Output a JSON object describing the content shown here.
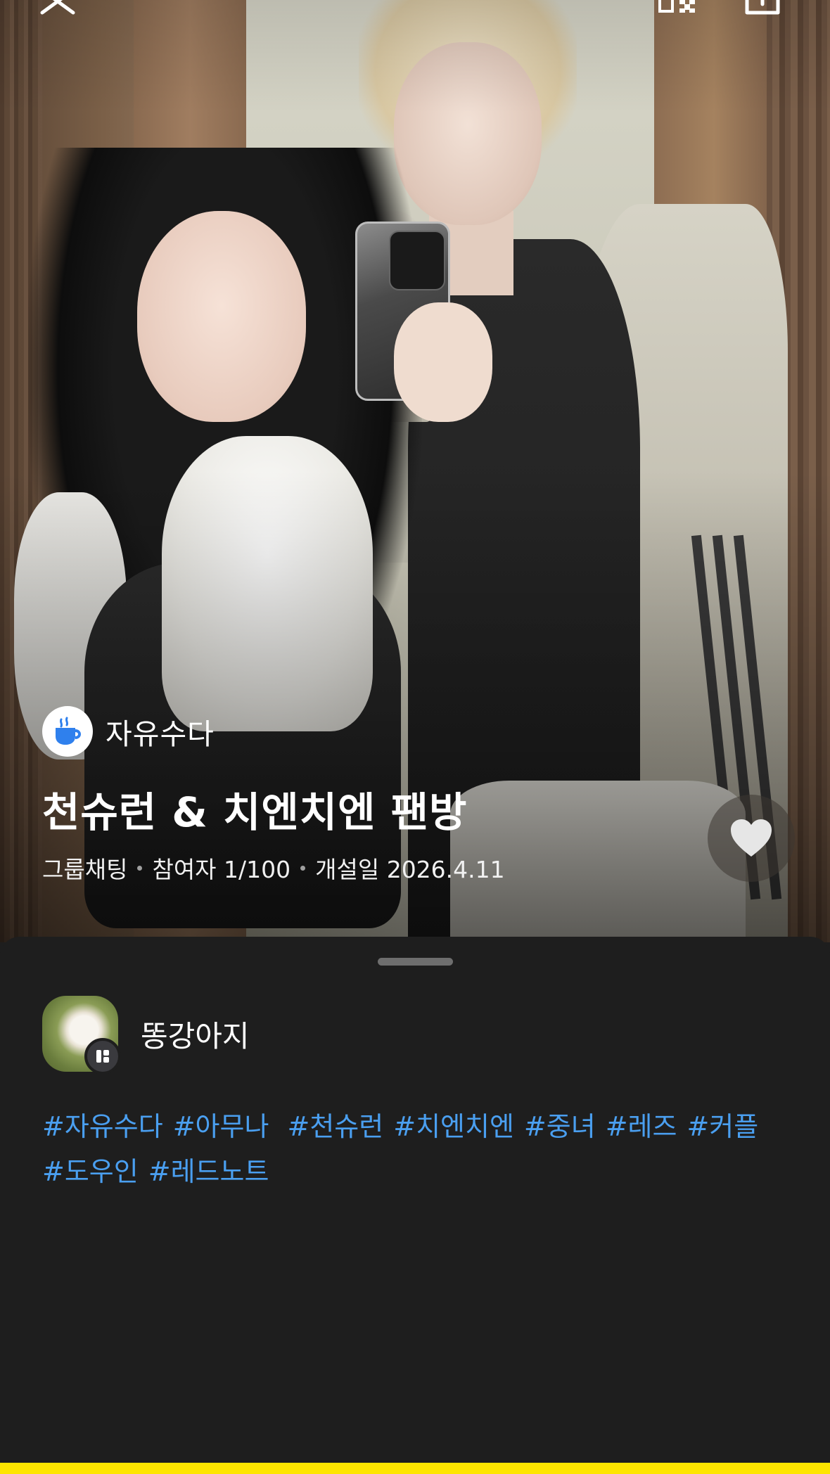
{
  "topbar": {
    "close_icon": "close-icon",
    "qr_icon": "qr-code-icon",
    "share_icon": "share-icon"
  },
  "category": {
    "icon": "coffee-cup-icon",
    "label": "자유수다",
    "icon_color": "#2f80ed"
  },
  "room": {
    "title": "천슈런 & 치엔치엔 팬방",
    "type": "그룹채팅",
    "participants": "참여자 1/100",
    "created": "개설일 2026.4.11"
  },
  "like": {
    "icon": "heart-icon"
  },
  "owner": {
    "nickname": "똥강아지",
    "badge_icon": "host-badge-icon"
  },
  "tags": [
    "#자유수다",
    "#아무나 ",
    "#천슈런",
    "#치엔치엔",
    "#중녀",
    "#레즈",
    "#커플",
    "#도우인",
    "#레드노트"
  ],
  "colors": {
    "sheet_bg": "#1e1e1e",
    "tag_color": "#4a9ff0",
    "join_bar": "#fee500"
  }
}
